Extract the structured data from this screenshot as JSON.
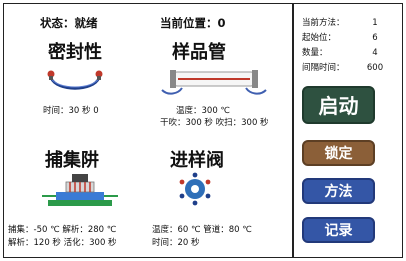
{
  "header": {
    "status_label": "状态：",
    "status_value": "就绪",
    "position_label": "当前位置：",
    "position_value": "0"
  },
  "seal": {
    "title": "密封性",
    "time_line": "时间：30  秒 0"
  },
  "sample_tube": {
    "title": "样品管",
    "temp_line": "温度：300  ℃",
    "dry_purge_line": "干吹：300  秒  吹扫：300  秒"
  },
  "trap": {
    "title": "捕集阱",
    "line1": "捕集：-50  ℃  解析：280  ℃",
    "line2": "解析：120  秒  活化：300  秒"
  },
  "valve": {
    "title": "进样阀",
    "line1": "温度：60  ℃  管道：80  ℃",
    "line2": "时间：20  秒"
  },
  "info": [
    {
      "label": "当前方法：",
      "value": "1"
    },
    {
      "label": "起始位：",
      "value": "6"
    },
    {
      "label": "数量：",
      "value": "4"
    },
    {
      "label": "间隔时间：",
      "value": "600"
    }
  ],
  "buttons": {
    "start": "启动",
    "lock": "锁定",
    "method": "方法",
    "record": "记录"
  },
  "colors": {
    "start": "#2e5140",
    "lock": "#8b5f38",
    "method": "#3456a6",
    "record": "#3456a6"
  }
}
